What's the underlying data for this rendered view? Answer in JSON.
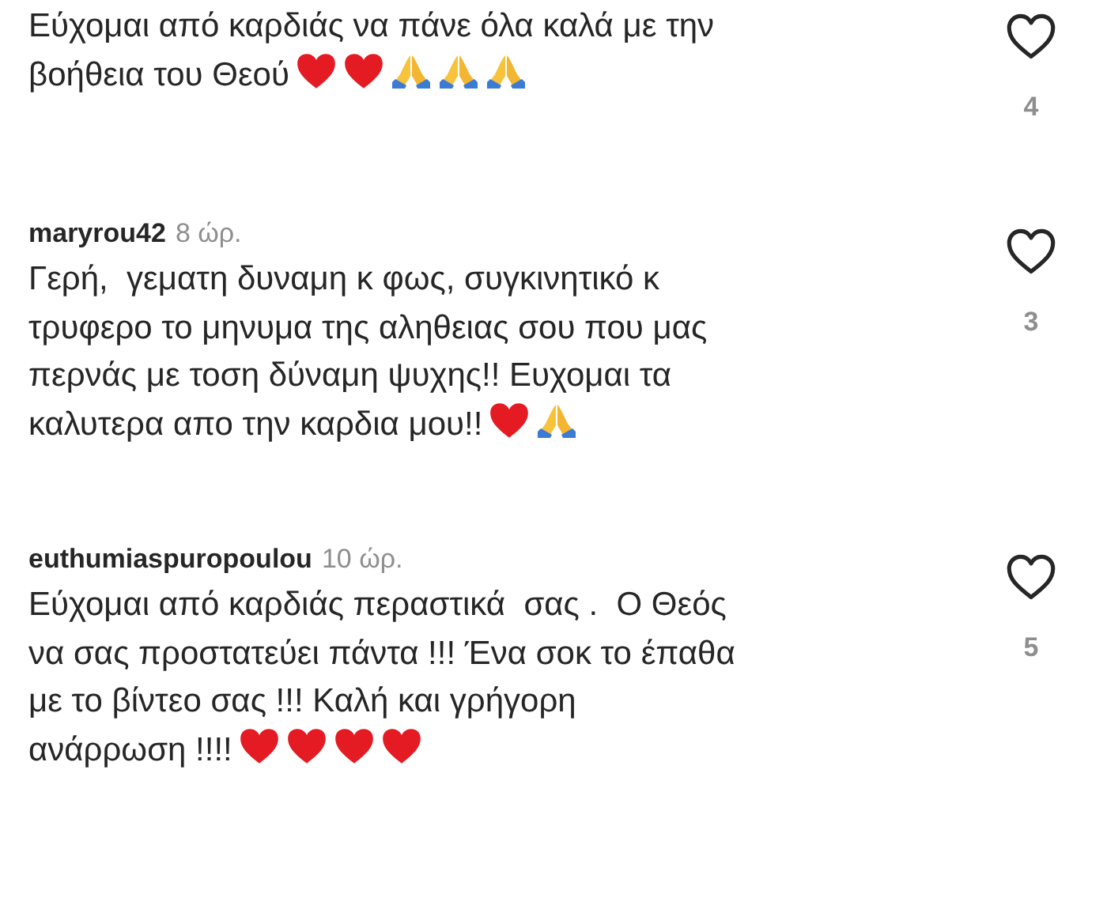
{
  "comments": [
    {
      "lines": [
        "Εύχομαι από καρδιάς να πάνε όλα καλά με την",
        "βοήθεια του Θεού"
      ],
      "emojis": [
        {
          "kind": "heart"
        },
        {
          "kind": "heart"
        },
        {
          "kind": "pray"
        },
        {
          "kind": "pray"
        },
        {
          "kind": "pray"
        }
      ],
      "likes": "4"
    },
    {
      "username": "maryrou42",
      "time": "8 ώρ.",
      "lines": [
        "Γερή,  γεματη δυναμη κ φως, συγκινητικό κ",
        "τρυφερο το μηνυμα της αληθειας σου που μας",
        "περνάς με τοση δύναμη ψυχης!! Ευχομαι τα",
        "καλυτερα απο την καρδια μου!!"
      ],
      "emojis": [
        {
          "kind": "heart"
        },
        {
          "kind": "pray"
        }
      ],
      "likes": "3"
    },
    {
      "username": "euthumiaspuropoulou",
      "time": "10 ώρ.",
      "lines": [
        "Εύχομαι από καρδιάς περαστικά  σας .  Ο Θεός",
        "να σας προστατεύει πάντα !!! Ένα σοκ το έπαθα",
        "με το βίντεο σας !!! Καλή και γρήγορη",
        "ανάρρωση !!!!"
      ],
      "emojis": [
        {
          "kind": "heart"
        },
        {
          "kind": "heart"
        },
        {
          "kind": "heart"
        },
        {
          "kind": "heart"
        }
      ],
      "likes": "5"
    }
  ]
}
